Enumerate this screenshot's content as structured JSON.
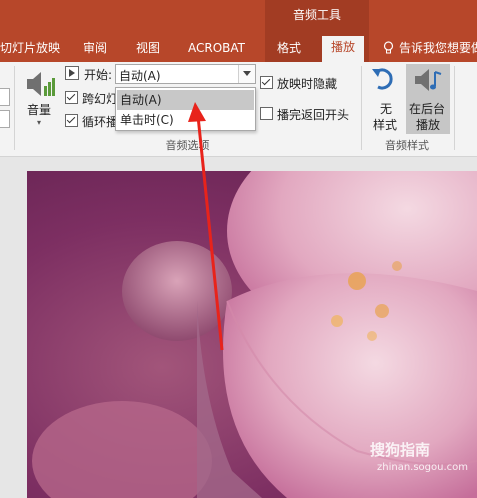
{
  "tabs": {
    "contextual_group": "音频工具",
    "items": [
      {
        "label": "切灯片放映"
      },
      {
        "label": "审阅"
      },
      {
        "label": "视图"
      },
      {
        "label": "ACROBAT"
      },
      {
        "label": "格式"
      },
      {
        "label": "播放"
      }
    ],
    "tell_me": "告诉我您想要做"
  },
  "ribbon": {
    "volume_label": "音量",
    "start_label": "开始:",
    "start_value": "自动(A)",
    "across_slides": "跨幻灯",
    "loop": "循环播",
    "hide_during_show": "放映时隐藏",
    "rewind_after": "播完返回开头",
    "audio_options_group": "音频选项",
    "no_style_line1": "无",
    "no_style_line2": "样式",
    "play_bg_line1": "在后台",
    "play_bg_line2": "播放",
    "audio_styles_group": "音频样式"
  },
  "dropdown": {
    "options": [
      {
        "label": "自动(A)",
        "selected": true
      },
      {
        "label": "单击时(C)",
        "selected": false
      }
    ]
  },
  "watermark": {
    "brand": "搜狗指南",
    "url": "zhinan.sogou.com"
  },
  "colors": {
    "accent": "#b7472a",
    "arrow": "#e8231b"
  }
}
